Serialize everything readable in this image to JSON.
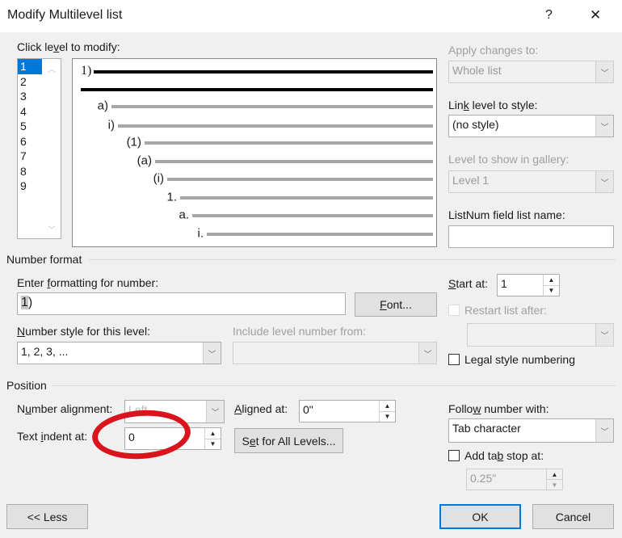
{
  "title": "Modify Multilevel list",
  "help_label": "?",
  "close_label": "✕",
  "click_level_label": "Click level to modify:",
  "levels": [
    "1",
    "2",
    "3",
    "4",
    "5",
    "6",
    "7",
    "8",
    "9"
  ],
  "selected_level": "1",
  "preview": {
    "labels": [
      "1)",
      "a)",
      "i)",
      "(1)",
      "(a)",
      "(i)",
      "1.",
      "a.",
      "i."
    ]
  },
  "apply_changes_label": "Apply changes to:",
  "apply_changes_value": "Whole list",
  "link_level_label": "Link level to style:",
  "link_level_value": "(no style)",
  "level_gallery_label": "Level to show in gallery:",
  "level_gallery_value": "Level 1",
  "listnum_label": "ListNum field list name:",
  "listnum_value": "",
  "number_format_section": "Number format",
  "enter_formatting_label": "Enter formatting for number:",
  "formatting_value": "1)",
  "font_button": "Font...",
  "number_style_label": "Number style for this level:",
  "number_style_value": "1, 2, 3, ...",
  "include_level_label": "Include level number from:",
  "include_level_value": "",
  "start_at_label": "Start at:",
  "start_at_value": "1",
  "restart_list_label": "Restart list after:",
  "restart_list_value": "",
  "legal_style_label": "Legal style numbering",
  "position_section": "Position",
  "number_alignment_label": "Number alignment:",
  "number_alignment_value": "Left",
  "aligned_at_label": "Aligned at:",
  "aligned_at_value": "0\"",
  "text_indent_label": "Text indent at:",
  "text_indent_value": "0",
  "set_all_levels_button": "Set for All Levels...",
  "follow_number_label": "Follow number with:",
  "follow_number_value": "Tab character",
  "add_tab_stop_label": "Add tab stop at:",
  "tab_stop_value": "0.25\"",
  "less_button": "<< Less",
  "ok_button": "OK",
  "cancel_button": "Cancel",
  "colors": {
    "selection": "#0078d7",
    "annotation": "#d9141c",
    "ok_border": "#0078d7"
  }
}
